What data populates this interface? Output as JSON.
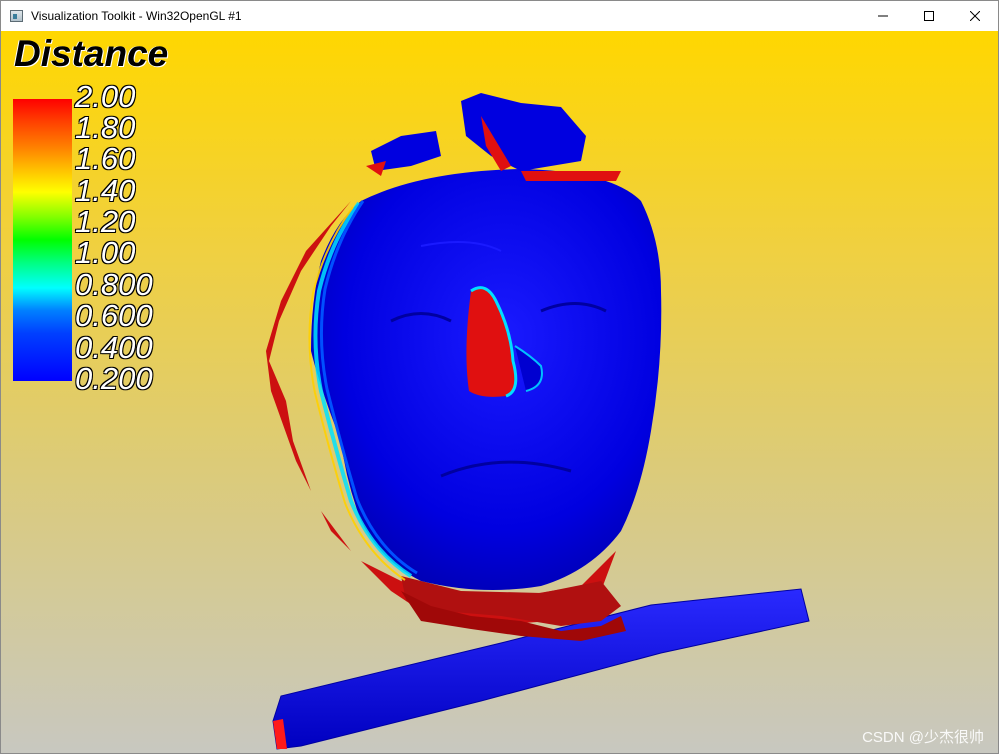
{
  "window": {
    "title": "Visualization Toolkit - Win32OpenGL #1",
    "icon": "vtk-app-icon",
    "controls": [
      "minimize-icon",
      "maximize-icon",
      "close-icon"
    ]
  },
  "legend": {
    "title": "Distance",
    "labels": [
      "2.00",
      "1.80",
      "1.60",
      "1.40",
      "1.20",
      "1.00",
      "0.800",
      "0.600",
      "0.400",
      "0.200"
    ],
    "colormap_top": "#ff0000",
    "colormap_bottom": "#0000ff"
  },
  "scene": {
    "background_top": "#ffd700",
    "background_bottom": "#c8c8c0",
    "primary_color": "#0000ff",
    "edge_color": "#ff0000",
    "objects": [
      "face-scan-mesh",
      "bar-mesh"
    ]
  },
  "watermark": "CSDN @少杰很帅"
}
